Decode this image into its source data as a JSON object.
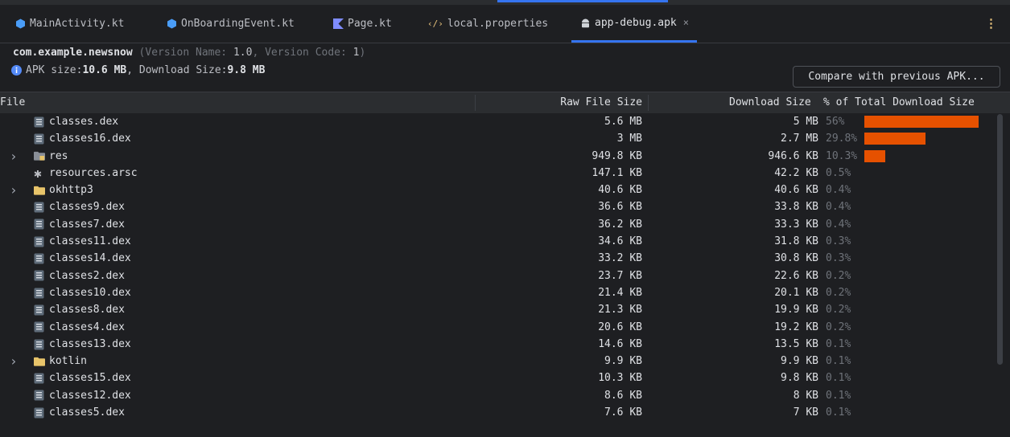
{
  "tabs": [
    {
      "label": "MainActivity.kt",
      "icon": "kotlin-class-icon",
      "active": false
    },
    {
      "label": "OnBoardingEvent.kt",
      "icon": "kotlin-class-icon",
      "active": false
    },
    {
      "label": "Page.kt",
      "icon": "kotlin-file-icon",
      "active": false
    },
    {
      "label": "local.properties",
      "icon": "properties-file-icon",
      "active": false
    },
    {
      "label": "app-debug.apk",
      "icon": "android-icon",
      "active": true
    }
  ],
  "tab_close": "×",
  "more_menu": "⋮",
  "info": {
    "package": "com.example.newsnow",
    "version_prefix": "(Version Name: ",
    "version_name": "1.0",
    "version_mid": ", Version Code: ",
    "version_code": "1",
    "version_suffix": ")",
    "apk_size_label": "APK size: ",
    "apk_size": "10.6 MB",
    "download_label": ", Download Size: ",
    "download_size": "9.8 MB"
  },
  "compare_button": "Compare with previous APK...",
  "columns": {
    "file": "File",
    "raw": "Raw File Size",
    "download": "Download Size",
    "percent": "% of Total Download Size"
  },
  "rows": [
    {
      "name": "classes.dex",
      "type": "dex",
      "raw": "5.6 MB",
      "download": "5 MB",
      "pct": "56%",
      "share": 56
    },
    {
      "name": "classes16.dex",
      "type": "dex",
      "raw": "3 MB",
      "download": "2.7 MB",
      "pct": "29.8%",
      "share": 29.8
    },
    {
      "name": "res",
      "type": "res-folder",
      "raw": "949.8 KB",
      "download": "946.6 KB",
      "pct": "10.3%",
      "share": 10.3,
      "expandable": true
    },
    {
      "name": "resources.arsc",
      "type": "arsc",
      "raw": "147.1 KB",
      "download": "42.2 KB",
      "pct": "0.5%",
      "share": 0.5
    },
    {
      "name": "okhttp3",
      "type": "folder",
      "raw": "40.6 KB",
      "download": "40.6 KB",
      "pct": "0.4%",
      "share": 0.4,
      "expandable": true
    },
    {
      "name": "classes9.dex",
      "type": "dex",
      "raw": "36.6 KB",
      "download": "33.8 KB",
      "pct": "0.4%",
      "share": 0.4
    },
    {
      "name": "classes7.dex",
      "type": "dex",
      "raw": "36.2 KB",
      "download": "33.3 KB",
      "pct": "0.4%",
      "share": 0.4
    },
    {
      "name": "classes11.dex",
      "type": "dex",
      "raw": "34.6 KB",
      "download": "31.8 KB",
      "pct": "0.3%",
      "share": 0.3
    },
    {
      "name": "classes14.dex",
      "type": "dex",
      "raw": "33.2 KB",
      "download": "30.8 KB",
      "pct": "0.3%",
      "share": 0.3
    },
    {
      "name": "classes2.dex",
      "type": "dex",
      "raw": "23.7 KB",
      "download": "22.6 KB",
      "pct": "0.2%",
      "share": 0.2
    },
    {
      "name": "classes10.dex",
      "type": "dex",
      "raw": "21.4 KB",
      "download": "20.1 KB",
      "pct": "0.2%",
      "share": 0.2
    },
    {
      "name": "classes8.dex",
      "type": "dex",
      "raw": "21.3 KB",
      "download": "19.9 KB",
      "pct": "0.2%",
      "share": 0.2
    },
    {
      "name": "classes4.dex",
      "type": "dex",
      "raw": "20.6 KB",
      "download": "19.2 KB",
      "pct": "0.2%",
      "share": 0.2
    },
    {
      "name": "classes13.dex",
      "type": "dex",
      "raw": "14.6 KB",
      "download": "13.5 KB",
      "pct": "0.1%",
      "share": 0.1
    },
    {
      "name": "kotlin",
      "type": "folder",
      "raw": "9.9 KB",
      "download": "9.9 KB",
      "pct": "0.1%",
      "share": 0.1,
      "expandable": true
    },
    {
      "name": "classes15.dex",
      "type": "dex",
      "raw": "10.3 KB",
      "download": "9.8 KB",
      "pct": "0.1%",
      "share": 0.1
    },
    {
      "name": "classes12.dex",
      "type": "dex",
      "raw": "8.6 KB",
      "download": "8 KB",
      "pct": "0.1%",
      "share": 0.1
    },
    {
      "name": "classes5.dex",
      "type": "dex",
      "raw": "7.6 KB",
      "download": "7 KB",
      "pct": "0.1%",
      "share": 0.1
    }
  ],
  "colors": {
    "background": "#1e1f22",
    "accent": "#3574f0",
    "bar": "#e65100",
    "folder": "#e8c46a",
    "kotlin": "#7f52ff",
    "android": "#a4c639"
  }
}
